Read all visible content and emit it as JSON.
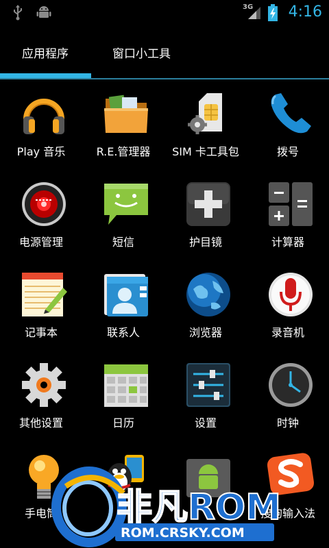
{
  "status_bar": {
    "network": "3G",
    "time": "4:16",
    "accent": "#33b5e5",
    "icons": [
      "usb-icon",
      "android-debug-icon",
      "signal-icon",
      "battery-charging-icon"
    ]
  },
  "tabs": [
    {
      "label": "应用程序",
      "selected": true
    },
    {
      "label": "窗口小工具",
      "selected": false
    }
  ],
  "apps": [
    {
      "label": "Play 音乐",
      "icon": "headphones-icon"
    },
    {
      "label": "R.E.管理器",
      "icon": "folder-icon"
    },
    {
      "label": "SIM 卡工具包",
      "icon": "sim-card-icon"
    },
    {
      "label": "拨号",
      "icon": "phone-icon"
    },
    {
      "label": "电源管理",
      "icon": "power-eye-icon"
    },
    {
      "label": "短信",
      "icon": "message-bubble-icon"
    },
    {
      "label": "护目镜",
      "icon": "plus-box-icon"
    },
    {
      "label": "计算器",
      "icon": "calculator-icon"
    },
    {
      "label": "记事本",
      "icon": "notepad-icon"
    },
    {
      "label": "联系人",
      "icon": "contacts-icon"
    },
    {
      "label": "浏览器",
      "icon": "globe-icon"
    },
    {
      "label": "录音机",
      "icon": "microphone-icon"
    },
    {
      "label": "其他设置",
      "icon": "gear-icon"
    },
    {
      "label": "日历",
      "icon": "calendar-icon"
    },
    {
      "label": "设置",
      "icon": "sliders-icon"
    },
    {
      "label": "时钟",
      "icon": "clock-icon"
    },
    {
      "label": "手电筒",
      "icon": "lightbulb-icon"
    },
    {
      "label": "",
      "icon": "qq-icon"
    },
    {
      "label": "",
      "icon": "android-box-icon"
    },
    {
      "label": "搜狗输入法",
      "icon": "sogou-icon"
    }
  ],
  "watermark": {
    "brand": "非凡ROM",
    "url": "ROM.CRSKY.COM"
  }
}
